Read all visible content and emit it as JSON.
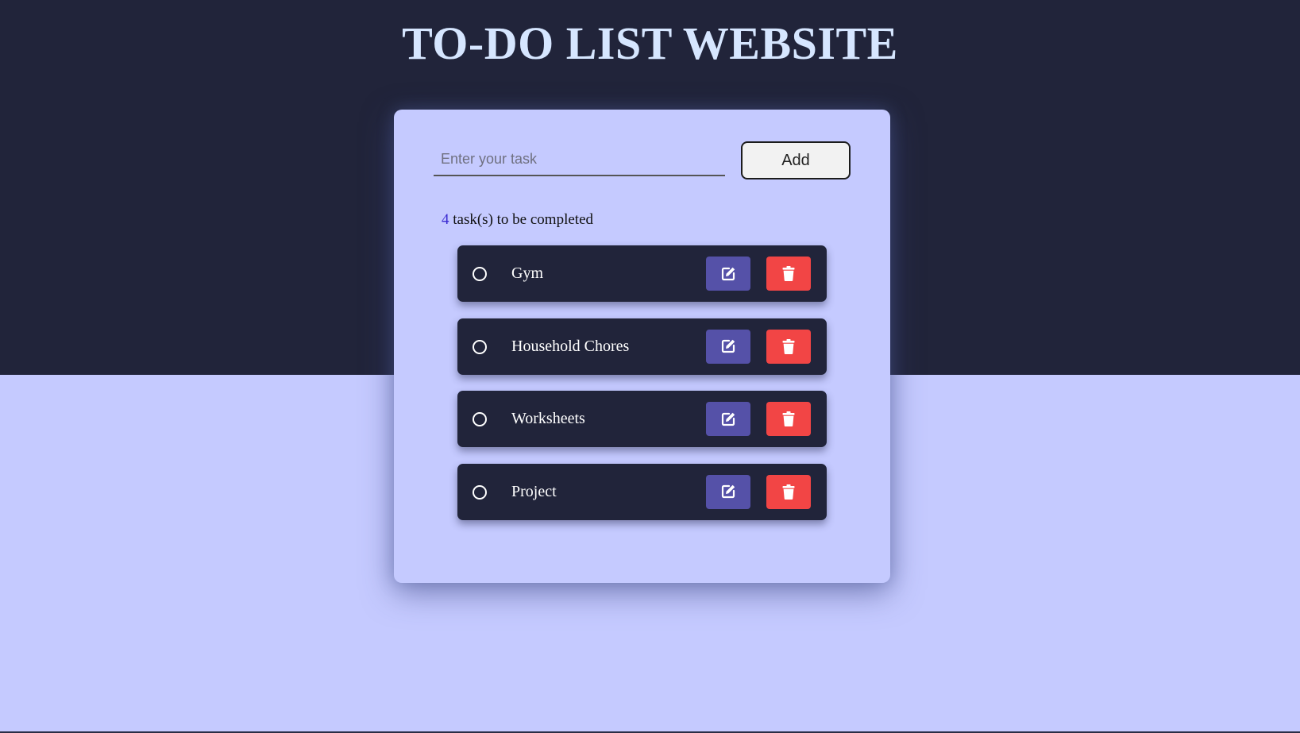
{
  "header": {
    "title": "TO-DO LIST WEBSITE"
  },
  "input": {
    "value": "",
    "placeholder": "Enter your task"
  },
  "add_button": {
    "label": "Add"
  },
  "counter": {
    "count": "4",
    "suffix": " task(s) to be completed"
  },
  "tasks": [
    {
      "label": "Gym",
      "completed": false
    },
    {
      "label": "Household Chores",
      "completed": false
    },
    {
      "label": "Worksheets",
      "completed": false
    },
    {
      "label": "Project",
      "completed": false
    }
  ],
  "icons": {
    "checkbox": "circle-outline-icon",
    "edit": "edit-icon",
    "delete": "trash-icon"
  },
  "colors": {
    "dark_band": "#21243a",
    "page_background": "#c5caff",
    "title": "#d6e6ff",
    "edit_button": "#5551a8",
    "delete_button": "#f24545",
    "count_number": "#3b2bd1"
  }
}
